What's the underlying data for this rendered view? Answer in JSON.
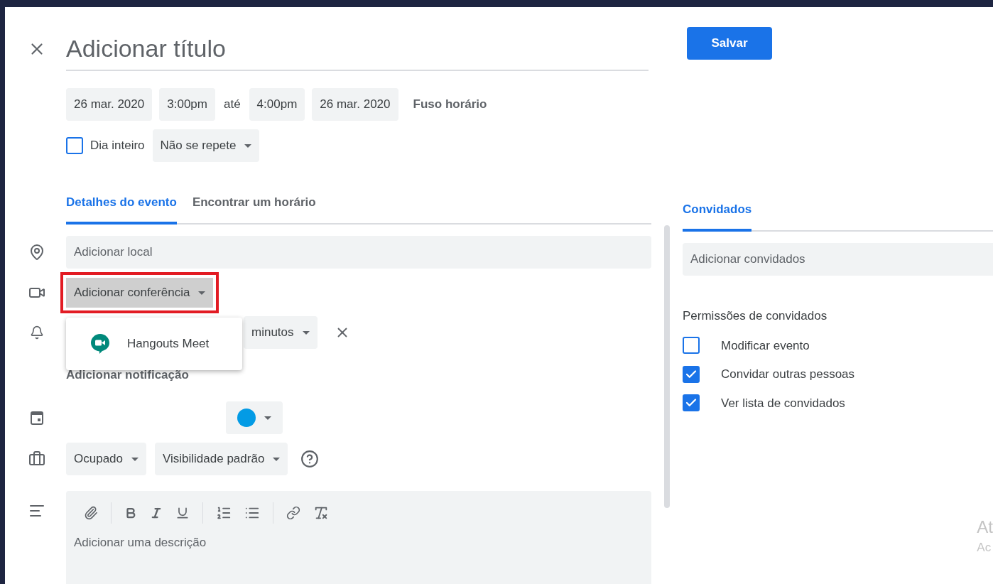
{
  "title_field": {
    "placeholder": "Adicionar título"
  },
  "save_button": "Salvar",
  "date_time": {
    "start_date": "26 mar. 2020",
    "start_time": "3:00pm",
    "separator": "até",
    "end_time": "4:00pm",
    "end_date": "26 mar. 2020",
    "timezone": "Fuso horário"
  },
  "all_day": {
    "label": "Dia inteiro",
    "checked": false
  },
  "repeat": {
    "value": "Não se repete"
  },
  "tabs": [
    {
      "label": "Detalhes do evento",
      "selected": true
    },
    {
      "label": "Encontrar um horário",
      "selected": false
    }
  ],
  "location": {
    "placeholder": "Adicionar local"
  },
  "conference": {
    "value": "Adicionar conferência",
    "highlighted": true,
    "menu": [
      {
        "label": "Hangouts Meet"
      }
    ]
  },
  "notification": {
    "unit": "minutos"
  },
  "add_notification": "Adicionar notificação",
  "status": {
    "availability": "Ocupado",
    "visibility": "Visibilidade padrão"
  },
  "description": {
    "placeholder": "Adicionar uma descrição"
  },
  "guests_panel": {
    "tab": {
      "label": "Convidados",
      "selected": true
    },
    "field": {
      "placeholder": "Adicionar convidados"
    },
    "permissions_title": "Permissões de convidados",
    "permissions": [
      {
        "label": "Modificar evento",
        "checked": false
      },
      {
        "label": "Convidar outras pessoas",
        "checked": true
      },
      {
        "label": "Ver lista de convidados",
        "checked": true
      }
    ]
  },
  "system_overlay": {
    "line_1": "At",
    "line_2": "Ac"
  }
}
